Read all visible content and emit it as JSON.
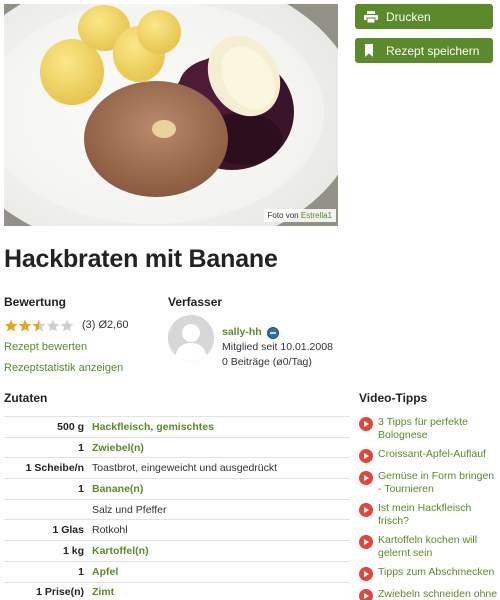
{
  "photo": {
    "credit_prefix": "Foto von",
    "credit_author": "Estrella1"
  },
  "actions": {
    "print_label": "Drucken",
    "save_label": "Rezept speichern"
  },
  "recipe": {
    "title": "Hackbraten mit Banane"
  },
  "rating": {
    "heading": "Bewertung",
    "stars": 2.5,
    "max_stars": 5,
    "count_text": "(3) Ø2,60",
    "rate_link": "Rezept bewerten",
    "stats_link": "Rezeptstatistik anzeigen"
  },
  "author": {
    "heading": "Verfasser",
    "name": "sally-hh",
    "member_since": "Mitglied seit 10.01.2008",
    "posts": "0 Beiträge (ø0/Tag)"
  },
  "ingredients": {
    "heading": "Zutaten",
    "items": [
      {
        "qty": "500 g",
        "name": "Hackfleisch, gemischtes",
        "link": true
      },
      {
        "qty": "1",
        "name": "Zwiebel(n)",
        "link": true
      },
      {
        "qty": "1 Scheibe/n",
        "name": "Toastbrot, eingeweicht und ausgedrückt",
        "link": false
      },
      {
        "qty": "1",
        "name": "Banane(n)",
        "link": true
      },
      {
        "qty": "",
        "name": "Salz und Pfeffer",
        "link": false
      },
      {
        "qty": "1 Glas",
        "name": "Rotkohl",
        "link": false
      },
      {
        "qty": "1 kg",
        "name": "Kartoffel(n)",
        "link": true
      },
      {
        "qty": "1",
        "name": "Apfel",
        "link": true
      },
      {
        "qty": "1 Prise(n)",
        "name": "Zimt",
        "link": true
      }
    ]
  },
  "videos": {
    "heading": "Video-Tipps",
    "items": [
      "3 Tipps für perfekte Bolognese",
      "Croissant-Apfel-Auflauf",
      "Gemüse in Form bringen - Tournieren",
      "Ist mein Hackfleisch frisch?",
      "Kartoffeln kochen will gelernt sein",
      "Tipps zum Abschmecken",
      "Zwiebeln schneiden ohne Weinen"
    ]
  },
  "colors": {
    "accent": "#5a8a2a",
    "star_filled": "#e0a81e",
    "star_empty": "#d0d0d0",
    "play_icon": "#e0483d"
  }
}
